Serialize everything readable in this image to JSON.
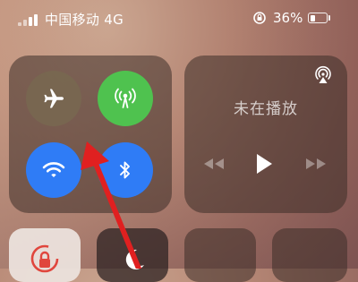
{
  "status_bar": {
    "carrier": "中国移动",
    "network": "4G",
    "battery_percent": "36%",
    "battery_level": 0.36
  },
  "media": {
    "title": "未在播放"
  },
  "icons": {
    "airplane": "airplane-icon",
    "cellular": "cellular-antenna-icon",
    "wifi": "wifi-icon",
    "bluetooth": "bluetooth-icon",
    "airplay": "airplay-icon",
    "rewind": "rewind-icon",
    "play": "play-icon",
    "forward": "fast-forward-icon",
    "lock_rotation": "orientation-lock-icon",
    "moon": "moon-icon"
  },
  "colors": {
    "cellular_active": "#4fc24f",
    "wifi_active": "#2f7cf6",
    "bluetooth_active": "#2f7cf6",
    "annotation_arrow": "#e02020"
  }
}
